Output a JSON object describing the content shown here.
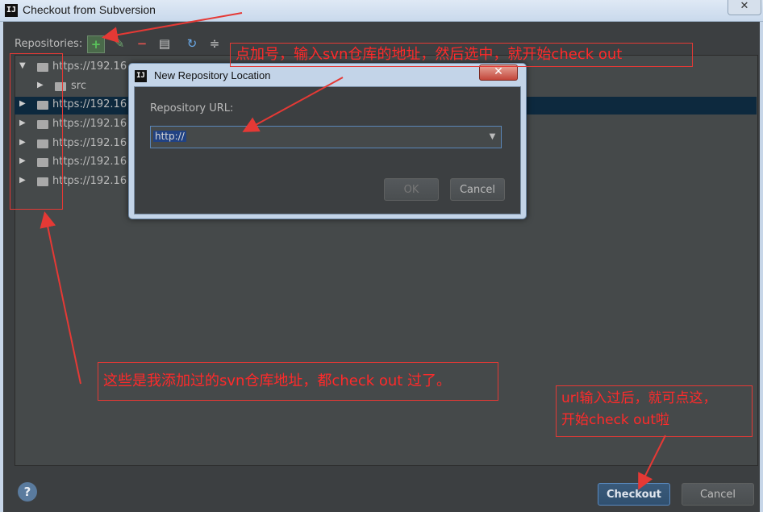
{
  "window": {
    "logo": "IJ",
    "title": "Checkout from Subversion",
    "close_icon": "✕"
  },
  "toolbar": {
    "label": "Repositories:",
    "add": "+",
    "edit": "✎",
    "remove": "−",
    "browse": "▤",
    "refresh": "↻",
    "collapse": "≑"
  },
  "tree": {
    "rows": [
      {
        "arrow": "▼",
        "label": "https://192.16",
        "selected": false
      },
      {
        "arrow": "▶",
        "label": "src",
        "selected": false
      },
      {
        "arrow": "▶",
        "label": "https://192.16",
        "selected": true
      },
      {
        "arrow": "▶",
        "label": "https://192.16",
        "selected": false
      },
      {
        "arrow": "▶",
        "label": "https://192.16",
        "selected": false
      },
      {
        "arrow": "▶",
        "label": "https://192.16",
        "selected": false
      },
      {
        "arrow": "▶",
        "label": "https://192.16",
        "selected": false
      }
    ]
  },
  "dialog": {
    "logo": "IJ",
    "title": "New Repository Location",
    "close_icon": "✕",
    "url_label": "Repository URL:",
    "url_value": "http://",
    "dropdown_icon": "▼",
    "ok_label": "OK",
    "cancel_label": "Cancel"
  },
  "footer": {
    "help_icon": "?",
    "checkout_label": "Checkout",
    "cancel_label": "Cancel"
  },
  "annotations": {
    "top": "点加号，输入svn仓库的地址，然后选中，就开始check out",
    "left": "这些是我添加过的svn仓库地址，都check out 过了。",
    "right_line1": "url输入过后，就可点这，",
    "right_line2": "开始check out啦"
  },
  "colors": {
    "annotation": "#e53935",
    "selection": "#0d293e",
    "background": "#3c3f41"
  }
}
